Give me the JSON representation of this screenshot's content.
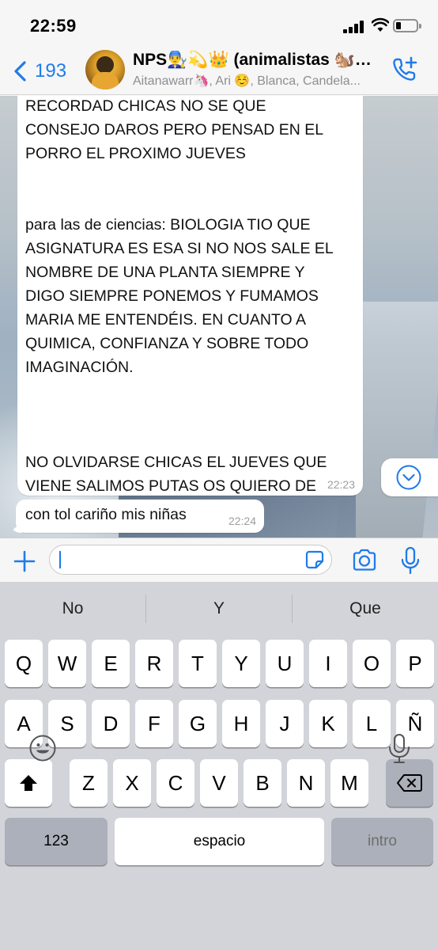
{
  "status_bar": {
    "time": "22:59"
  },
  "header": {
    "back_count": "193",
    "title": "NPS👨‍🔧💫👑 (animalistas 🐿️…",
    "subtitle": "Aitanawarr🦄, Ari ☺️, Blanca, Candela..."
  },
  "messages": [
    {
      "text": "RECORDAD CHICAS NO SE QUE\nCONSEJO DAROS PERO PENSAD EN EL\nPORRO EL PROXIMO JUEVES\n\n\npara las de ciencias: BIOLOGIA TIO QUE\nASIGNATURA ES ESA SI NO NOS SALE EL\nNOMBRE DE UNA PLANTA SIEMPRE Y\nDIGO SIEMPRE PONEMOS Y FUMAMOS\nMARIA ME ENTENDÉIS. EN CUANTO A\nQUIMICA, CONFIANZA Y SOBRE TODO\nIMAGINACIÓN.\n\n\n\nNO OLVIDARSE CHICAS EL JUEVES QUE\nVIENE SALIMOS PUTAS OS QUIERO DE\nNADA",
      "time": "22:23"
    },
    {
      "text": "con tol cariño mis niñas",
      "time": "22:24"
    }
  ],
  "input": {
    "value": ""
  },
  "keyboard": {
    "suggestions": [
      "No",
      "Y",
      "Que"
    ],
    "row1": [
      "Q",
      "W",
      "E",
      "R",
      "T",
      "Y",
      "U",
      "I",
      "O",
      "P"
    ],
    "row2": [
      "A",
      "S",
      "D",
      "F",
      "G",
      "H",
      "J",
      "K",
      "L",
      "Ñ"
    ],
    "row3": [
      "Z",
      "X",
      "C",
      "V",
      "B",
      "N",
      "M"
    ],
    "numbers_label": "123",
    "space_label": "espacio",
    "return_label": "intro"
  },
  "colors": {
    "accent": "#1f7bea",
    "bubble": "#ffffff",
    "keyboard_bg": "#d2d4da"
  }
}
